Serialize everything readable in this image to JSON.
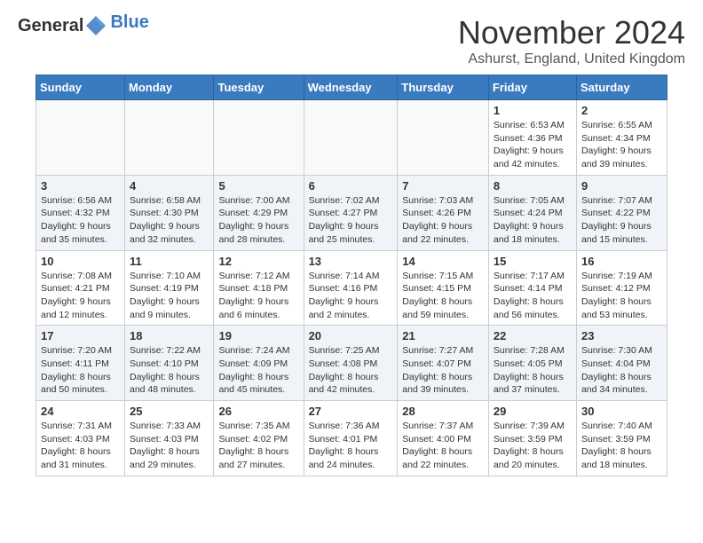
{
  "header": {
    "logo_general": "General",
    "logo_blue": "Blue",
    "month_title": "November 2024",
    "location": "Ashurst, England, United Kingdom"
  },
  "days_of_week": [
    "Sunday",
    "Monday",
    "Tuesday",
    "Wednesday",
    "Thursday",
    "Friday",
    "Saturday"
  ],
  "weeks": [
    [
      {
        "day": "",
        "info": ""
      },
      {
        "day": "",
        "info": ""
      },
      {
        "day": "",
        "info": ""
      },
      {
        "day": "",
        "info": ""
      },
      {
        "day": "",
        "info": ""
      },
      {
        "day": "1",
        "info": "Sunrise: 6:53 AM\nSunset: 4:36 PM\nDaylight: 9 hours and 42 minutes."
      },
      {
        "day": "2",
        "info": "Sunrise: 6:55 AM\nSunset: 4:34 PM\nDaylight: 9 hours and 39 minutes."
      }
    ],
    [
      {
        "day": "3",
        "info": "Sunrise: 6:56 AM\nSunset: 4:32 PM\nDaylight: 9 hours and 35 minutes."
      },
      {
        "day": "4",
        "info": "Sunrise: 6:58 AM\nSunset: 4:30 PM\nDaylight: 9 hours and 32 minutes."
      },
      {
        "day": "5",
        "info": "Sunrise: 7:00 AM\nSunset: 4:29 PM\nDaylight: 9 hours and 28 minutes."
      },
      {
        "day": "6",
        "info": "Sunrise: 7:02 AM\nSunset: 4:27 PM\nDaylight: 9 hours and 25 minutes."
      },
      {
        "day": "7",
        "info": "Sunrise: 7:03 AM\nSunset: 4:26 PM\nDaylight: 9 hours and 22 minutes."
      },
      {
        "day": "8",
        "info": "Sunrise: 7:05 AM\nSunset: 4:24 PM\nDaylight: 9 hours and 18 minutes."
      },
      {
        "day": "9",
        "info": "Sunrise: 7:07 AM\nSunset: 4:22 PM\nDaylight: 9 hours and 15 minutes."
      }
    ],
    [
      {
        "day": "10",
        "info": "Sunrise: 7:08 AM\nSunset: 4:21 PM\nDaylight: 9 hours and 12 minutes."
      },
      {
        "day": "11",
        "info": "Sunrise: 7:10 AM\nSunset: 4:19 PM\nDaylight: 9 hours and 9 minutes."
      },
      {
        "day": "12",
        "info": "Sunrise: 7:12 AM\nSunset: 4:18 PM\nDaylight: 9 hours and 6 minutes."
      },
      {
        "day": "13",
        "info": "Sunrise: 7:14 AM\nSunset: 4:16 PM\nDaylight: 9 hours and 2 minutes."
      },
      {
        "day": "14",
        "info": "Sunrise: 7:15 AM\nSunset: 4:15 PM\nDaylight: 8 hours and 59 minutes."
      },
      {
        "day": "15",
        "info": "Sunrise: 7:17 AM\nSunset: 4:14 PM\nDaylight: 8 hours and 56 minutes."
      },
      {
        "day": "16",
        "info": "Sunrise: 7:19 AM\nSunset: 4:12 PM\nDaylight: 8 hours and 53 minutes."
      }
    ],
    [
      {
        "day": "17",
        "info": "Sunrise: 7:20 AM\nSunset: 4:11 PM\nDaylight: 8 hours and 50 minutes."
      },
      {
        "day": "18",
        "info": "Sunrise: 7:22 AM\nSunset: 4:10 PM\nDaylight: 8 hours and 48 minutes."
      },
      {
        "day": "19",
        "info": "Sunrise: 7:24 AM\nSunset: 4:09 PM\nDaylight: 8 hours and 45 minutes."
      },
      {
        "day": "20",
        "info": "Sunrise: 7:25 AM\nSunset: 4:08 PM\nDaylight: 8 hours and 42 minutes."
      },
      {
        "day": "21",
        "info": "Sunrise: 7:27 AM\nSunset: 4:07 PM\nDaylight: 8 hours and 39 minutes."
      },
      {
        "day": "22",
        "info": "Sunrise: 7:28 AM\nSunset: 4:05 PM\nDaylight: 8 hours and 37 minutes."
      },
      {
        "day": "23",
        "info": "Sunrise: 7:30 AM\nSunset: 4:04 PM\nDaylight: 8 hours and 34 minutes."
      }
    ],
    [
      {
        "day": "24",
        "info": "Sunrise: 7:31 AM\nSunset: 4:03 PM\nDaylight: 8 hours and 31 minutes."
      },
      {
        "day": "25",
        "info": "Sunrise: 7:33 AM\nSunset: 4:03 PM\nDaylight: 8 hours and 29 minutes."
      },
      {
        "day": "26",
        "info": "Sunrise: 7:35 AM\nSunset: 4:02 PM\nDaylight: 8 hours and 27 minutes."
      },
      {
        "day": "27",
        "info": "Sunrise: 7:36 AM\nSunset: 4:01 PM\nDaylight: 8 hours and 24 minutes."
      },
      {
        "day": "28",
        "info": "Sunrise: 7:37 AM\nSunset: 4:00 PM\nDaylight: 8 hours and 22 minutes."
      },
      {
        "day": "29",
        "info": "Sunrise: 7:39 AM\nSunset: 3:59 PM\nDaylight: 8 hours and 20 minutes."
      },
      {
        "day": "30",
        "info": "Sunrise: 7:40 AM\nSunset: 3:59 PM\nDaylight: 8 hours and 18 minutes."
      }
    ]
  ]
}
